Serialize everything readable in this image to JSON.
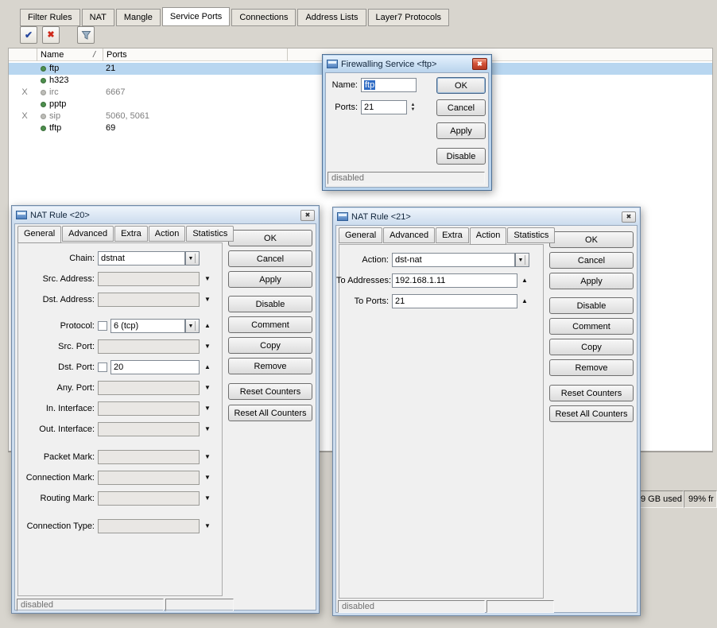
{
  "icons": {
    "check": "✔",
    "discard": "✖",
    "close": "✖",
    "chevron_down": "▼",
    "chevron_up": "▲"
  },
  "main": {
    "tabs": [
      "Filter Rules",
      "NAT",
      "Mangle",
      "Service Ports",
      "Connections",
      "Address Lists",
      "Layer7 Protocols"
    ],
    "active_tab": "Service Ports",
    "table": {
      "columns": {
        "name": "Name",
        "ports": "Ports"
      },
      "sort_indicator": "/",
      "rows": [
        {
          "flag": "",
          "name": "ftp",
          "ports": "21"
        },
        {
          "flag": "",
          "name": "h323",
          "ports": ""
        },
        {
          "flag": "X",
          "name": "irc",
          "ports": "6667"
        },
        {
          "flag": "",
          "name": "pptp",
          "ports": ""
        },
        {
          "flag": "X",
          "name": "sip",
          "ports": "5060, 5061"
        },
        {
          "flag": "",
          "name": "tftp",
          "ports": "69"
        }
      ]
    },
    "statusbar": {
      "disk_used": "9 GB used",
      "free": "99% fr"
    }
  },
  "service_dialog": {
    "title": "Firewalling Service <ftp>",
    "fields": {
      "name": {
        "label": "Name:",
        "value": "ftp"
      },
      "ports": {
        "label": "Ports:",
        "value": "21"
      }
    },
    "buttons": {
      "ok": "OK",
      "cancel": "Cancel",
      "apply": "Apply",
      "disable": "Disable"
    },
    "status": "disabled"
  },
  "nat_rule_20": {
    "title": "NAT Rule <20>",
    "tabs": [
      "General",
      "Advanced",
      "Extra",
      "Action",
      "Statistics"
    ],
    "active_tab": "General",
    "fields": {
      "chain": {
        "label": "Chain:",
        "value": "dstnat"
      },
      "src_address": {
        "label": "Src. Address:",
        "value": ""
      },
      "dst_address": {
        "label": "Dst. Address:",
        "value": ""
      },
      "protocol": {
        "label": "Protocol:",
        "value": "6 (tcp)"
      },
      "src_port": {
        "label": "Src. Port:",
        "value": ""
      },
      "dst_port": {
        "label": "Dst. Port:",
        "value": "20"
      },
      "any_port": {
        "label": "Any. Port:",
        "value": ""
      },
      "in_interface": {
        "label": "In. Interface:",
        "value": ""
      },
      "out_interface": {
        "label": "Out. Interface:",
        "value": ""
      },
      "packet_mark": {
        "label": "Packet Mark:",
        "value": ""
      },
      "connection_mark": {
        "label": "Connection Mark:",
        "value": ""
      },
      "routing_mark": {
        "label": "Routing Mark:",
        "value": ""
      },
      "connection_type": {
        "label": "Connection Type:",
        "value": ""
      }
    },
    "buttons": [
      "OK",
      "Cancel",
      "Apply",
      "Disable",
      "Comment",
      "Copy",
      "Remove",
      "Reset Counters",
      "Reset All Counters"
    ],
    "status": "disabled"
  },
  "nat_rule_21": {
    "title": "NAT Rule <21>",
    "tabs": [
      "General",
      "Advanced",
      "Extra",
      "Action",
      "Statistics"
    ],
    "active_tab": "Action",
    "fields": {
      "action": {
        "label": "Action:",
        "value": "dst-nat"
      },
      "to_addresses": {
        "label": "To Addresses:",
        "value": "192.168.1.11"
      },
      "to_ports": {
        "label": "To Ports:",
        "value": "21"
      }
    },
    "buttons": [
      "OK",
      "Cancel",
      "Apply",
      "Disable",
      "Comment",
      "Copy",
      "Remove",
      "Reset Counters",
      "Reset All Counters"
    ],
    "status": "disabled"
  }
}
